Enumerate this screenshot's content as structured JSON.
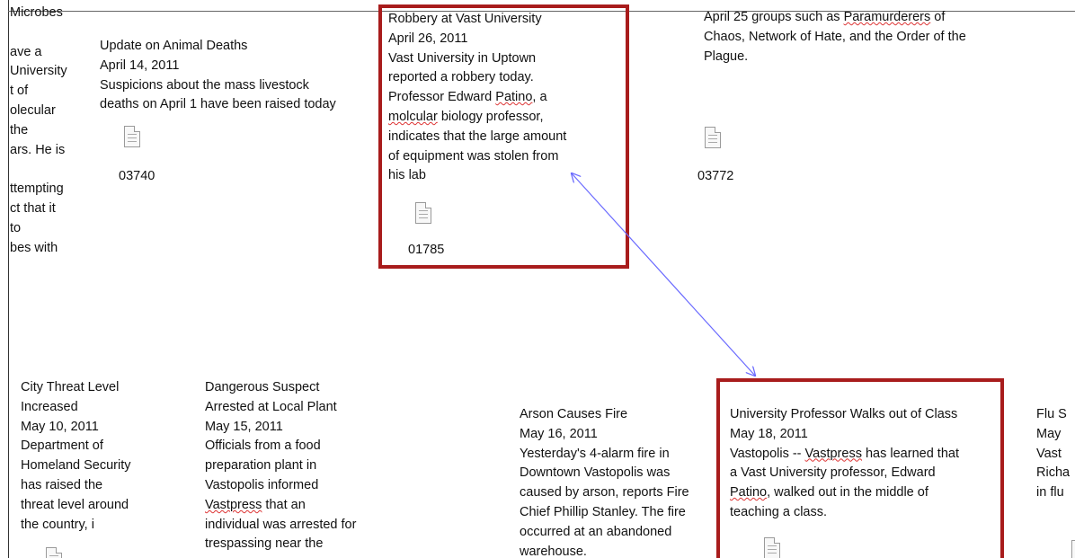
{
  "notes": {
    "left_clipped": "Microbes\n\nave a\nUniversity\nt of\nolecular\nthe\nars. He is\n\nttempting\nct that it\n to\nbes with",
    "animal_deaths": {
      "headline": "Update on Animal Deaths",
      "date": "April 14, 2011",
      "body": "Suspicions about the mass livestock\ndeaths on April 1 have been raised today",
      "doc_id": "03740"
    },
    "robbery": {
      "headline": "Robbery at Vast University",
      "date": "April 26, 2011",
      "body_line1": "Vast University in Uptown",
      "body_line2": "reported a robbery today.",
      "body_line3_prefix": "Professor Edward ",
      "body_line3_name": "Patino",
      "body_line3_suffix": ", a",
      "body_line4_word": "molcular",
      "body_line4_rest": " biology professor,",
      "body_rest": "indicates that the large amount\nof equipment was stolen from\nhis lab",
      "doc_id": "01785"
    },
    "groups": {
      "line1_prefix": "April 25 groups such as ",
      "line1_link": "Paramurderers",
      "line1_suffix": " of",
      "rest": "Chaos, Network of Hate, and the Order of the\nPlague.",
      "doc_id": "03772"
    },
    "threat_level": {
      "text": "City Threat Level\nIncreased\nMay 10, 2011\nDepartment of\nHomeland Security\nhas raised the\nthreat level around\nthe country, i"
    },
    "suspect": {
      "text_head": "Dangerous Suspect\nArrested at Local Plant\nMay 15, 2011\nOfficials from a food\npreparation plant in\nVastopolis informed",
      "vastpress": "Vastpress",
      "text_tail_1": " that an",
      "text_tail_2": "individual was arrested for\ntrespassing near the"
    },
    "arson": {
      "text": "Arson Causes Fire\nMay 16, 2011\nYesterday's 4-alarm fire in\nDowntown Vastopolis was\ncaused by arson, reports Fire\nChief Phillip Stanley. The fire\noccurred at an abandoned\nwarehouse."
    },
    "walkout": {
      "headline": "University Professor Walks out of Class",
      "date": "May 18, 2011",
      "line1_prefix": "Vastopolis -- ",
      "line1_link": "Vastpress",
      "line1_suffix": " has learned that",
      "line2": "a Vast University professor, Edward",
      "line3_name": "Patino",
      "line3_suffix": ", walked out in the middle of",
      "line4": "teaching a class."
    },
    "flu_clipped": {
      "text": "Flu S\nMay\nVast\nRicha\nin flu"
    }
  },
  "colors": {
    "highlight_box": "#a81c1c",
    "link_arrow": "#6b6bff"
  }
}
